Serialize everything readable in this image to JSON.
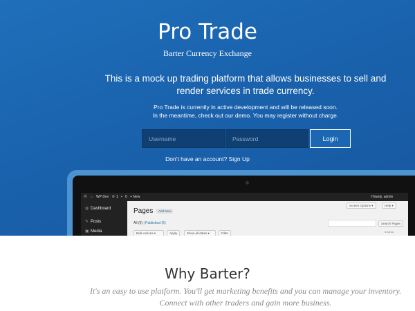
{
  "hero": {
    "title": "Pro Trade",
    "subtitle": "Barter Currency Exchange",
    "lead": "This is a mock up trading platform that allows businesses to sell and render services in trade currency.",
    "note_line1": "Pro Trade is currently in active development and will be released soon.",
    "note_line2": "In the meantime, check out our demo. You may register without charge."
  },
  "login": {
    "username_placeholder": "Username",
    "password_placeholder": "Password",
    "button_label": "Login",
    "signup_text": "Don't have an account? Sign Up"
  },
  "laptop_screen": {
    "admin_bar": {
      "site_name": "WP Dev",
      "updates": "1",
      "comments": "0",
      "new_label": "+ New",
      "greeting": "Howdy, admin"
    },
    "sidebar": [
      {
        "label": "Dashboard",
        "icon": "dashboard-icon",
        "glyph": "◍"
      },
      {
        "label": "Posts",
        "icon": "pushpin-icon",
        "glyph": "✎"
      },
      {
        "label": "Media",
        "icon": "media-icon",
        "glyph": "▣"
      }
    ],
    "screen_options_label": "Screen Options ▾",
    "help_label": "Help ▾",
    "page_title": "Pages",
    "add_new_label": "Add New",
    "filter_all": "All (5)",
    "filter_published": "Published (5)",
    "search_button": "Search Pages",
    "bulk_actions": "Bulk Actions",
    "apply_label": "Apply",
    "dates_select": "Show all dates",
    "filter_button": "Filter",
    "items_count": "5 items"
  },
  "why": {
    "heading": "Why Barter?",
    "text_line1": "It's an easy to use platform. You'll get marketing benefits and you can manage your inventory.",
    "text_line2": "Connect with other traders and gain more business."
  },
  "colors": {
    "hero_blue": "#1a62ad",
    "input_dark_blue": "#0f3f73",
    "laptop_frame": "#4c93d1"
  }
}
